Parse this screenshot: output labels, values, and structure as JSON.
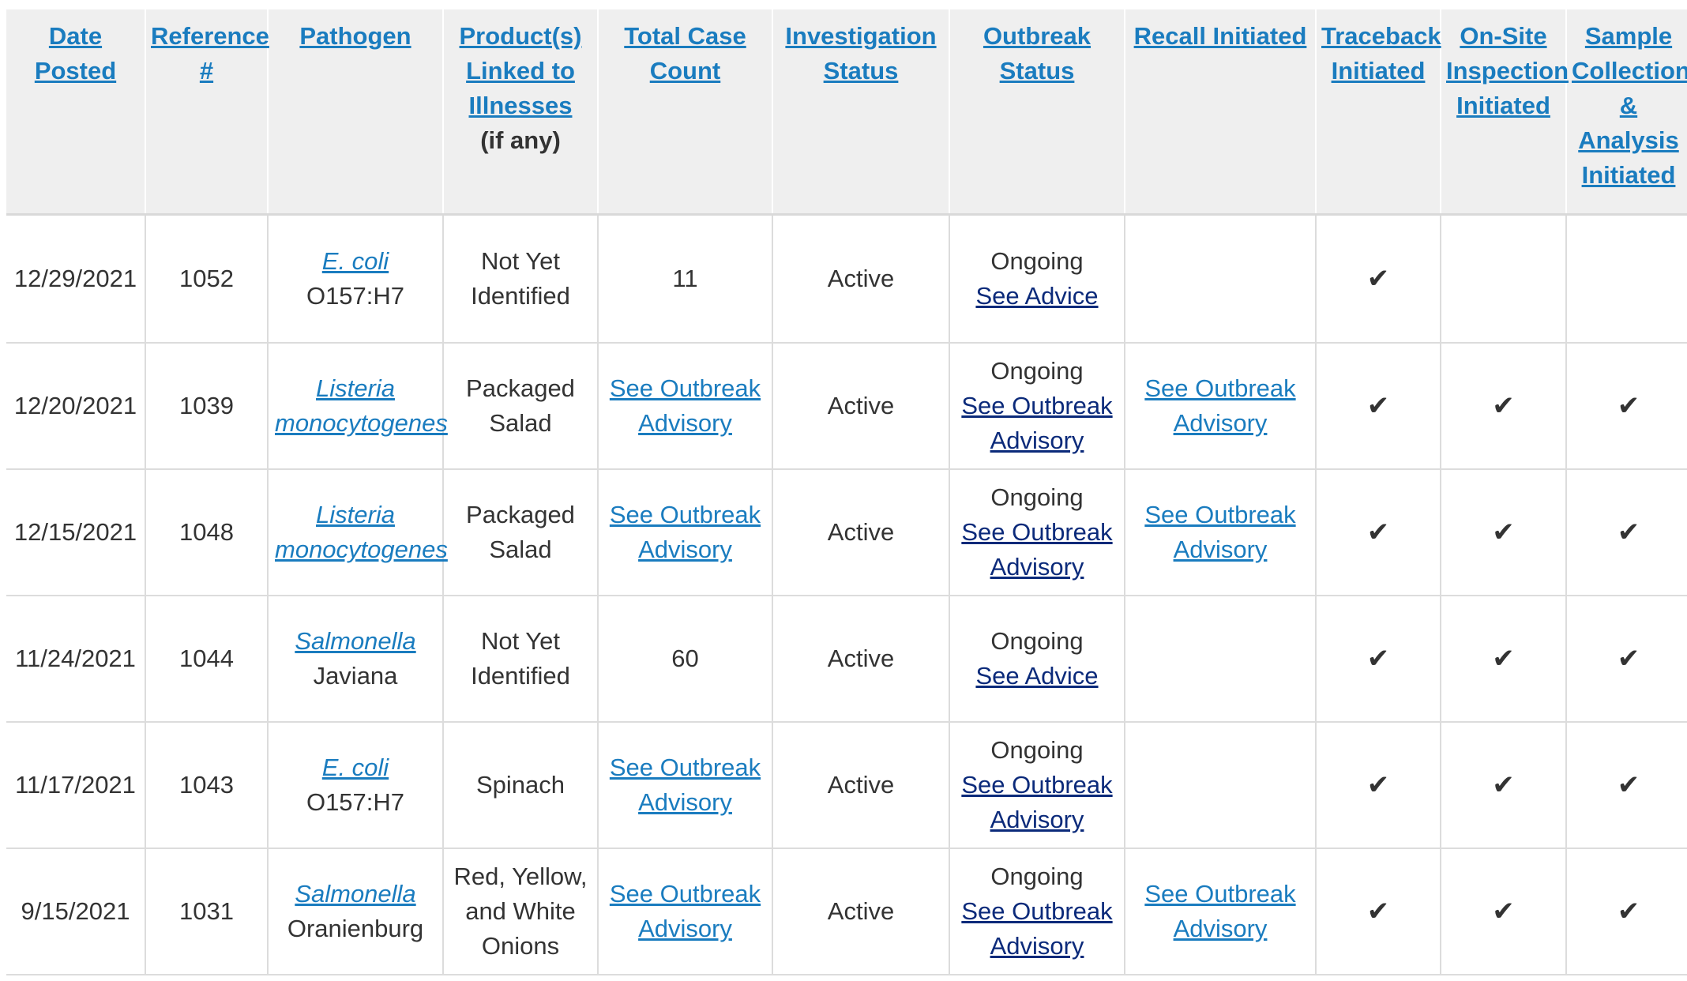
{
  "columns": [
    {
      "label": "Date Posted",
      "key": "date"
    },
    {
      "label": "Reference #",
      "key": "ref"
    },
    {
      "label": "Pathogen",
      "key": "pathogen"
    },
    {
      "label": "Product(s) Linked to Illnesses",
      "note": "(if any)",
      "key": "product"
    },
    {
      "label": "Total Case Count",
      "key": "cases"
    },
    {
      "label": "Investigation Status",
      "key": "investigation"
    },
    {
      "label": "Outbreak Status",
      "key": "outbreak"
    },
    {
      "label": "Recall Initiated",
      "key": "recall"
    },
    {
      "label": "Traceback Initiated",
      "key": "traceback"
    },
    {
      "label": "On-Site Inspection Initiated",
      "key": "inspection"
    },
    {
      "label": "Sample Collection & Analysis Initiated",
      "key": "sample"
    }
  ],
  "check_mark": "✔",
  "rows": [
    {
      "date": "12/29/2021",
      "ref": "1052",
      "pathogen_link": "E. coli",
      "pathogen_rest": " O157:H7",
      "product": "Not Yet Identified",
      "cases": "11",
      "cases_is_link": false,
      "investigation": "Active",
      "outbreak_status": "Ongoing",
      "outbreak_link": "See Advice",
      "recall": "",
      "traceback": true,
      "inspection": false,
      "sample": false
    },
    {
      "date": "12/20/2021",
      "ref": "1039",
      "pathogen_link": "Listeria monocytogenes",
      "pathogen_rest": "",
      "product": "Packaged Salad",
      "cases": "See Outbreak Advisory",
      "cases_is_link": true,
      "investigation": "Active",
      "outbreak_status": "Ongoing",
      "outbreak_link": "See Outbreak Advisory",
      "recall": "See Outbreak Advisory",
      "traceback": true,
      "inspection": true,
      "sample": true
    },
    {
      "date": "12/15/2021",
      "ref": "1048",
      "pathogen_link": "Listeria monocytogenes",
      "pathogen_rest": "",
      "product": "Packaged Salad",
      "cases": "See Outbreak Advisory",
      "cases_is_link": true,
      "investigation": "Active",
      "outbreak_status": "Ongoing",
      "outbreak_link": "See Outbreak Advisory",
      "recall": "See Outbreak Advisory",
      "traceback": true,
      "inspection": true,
      "sample": true
    },
    {
      "date": "11/24/2021",
      "ref": "1044",
      "pathogen_link": "Salmonella",
      "pathogen_rest": "Javiana",
      "product": "Not Yet Identified",
      "cases": "60",
      "cases_is_link": false,
      "investigation": "Active",
      "outbreak_status": "Ongoing",
      "outbreak_link": "See Advice",
      "recall": "",
      "traceback": true,
      "inspection": true,
      "sample": true
    },
    {
      "date": "11/17/2021",
      "ref": "1043",
      "pathogen_link": "E. coli",
      "pathogen_rest": "O157:H7",
      "product": "Spinach",
      "cases": "See Outbreak Advisory",
      "cases_is_link": true,
      "investigation": "Active",
      "outbreak_status": "Ongoing",
      "outbreak_link": "See Outbreak Advisory",
      "recall": "",
      "traceback": true,
      "inspection": true,
      "sample": true
    },
    {
      "date": "9/15/2021",
      "ref": "1031",
      "pathogen_link": "Salmonella",
      "pathogen_rest": "Oranienburg",
      "product": "Red, Yellow, and White Onions",
      "cases": "See Outbreak Advisory",
      "cases_is_link": true,
      "investigation": "Active",
      "outbreak_status": "Ongoing",
      "outbreak_link": "See Outbreak Advisory",
      "recall": "See Outbreak Advisory",
      "traceback": true,
      "inspection": true,
      "sample": true
    }
  ],
  "colors": {
    "header_link": "#1a7cbf",
    "outbreak_link": "#0b2a7a",
    "header_bg": "#efefef",
    "text": "#333333"
  }
}
